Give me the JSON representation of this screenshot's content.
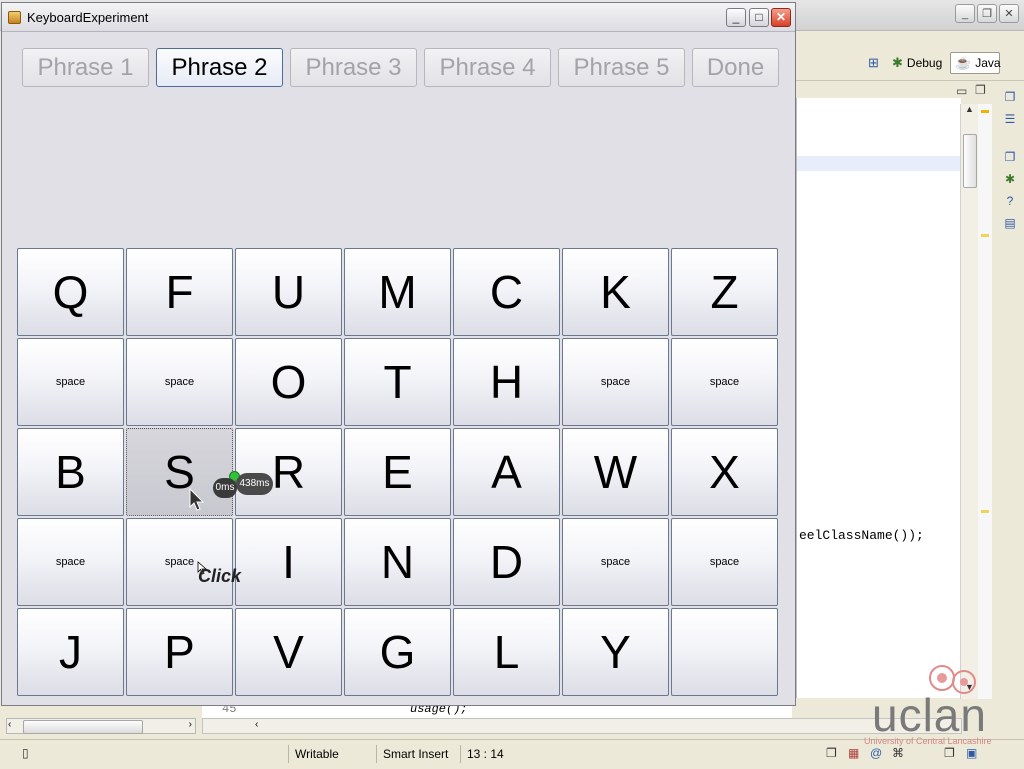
{
  "ide": {
    "perspectives": [
      {
        "label": "Debug",
        "icon": "debug-bug-icon"
      },
      {
        "label": "Java",
        "icon": "java-perspective-icon"
      }
    ],
    "code_fragment": "eelClassName());",
    "line_number": "45",
    "code_usage": "usage();",
    "status": {
      "writable": "Writable",
      "insert_mode": "Smart Insert",
      "position": "13 : 14"
    },
    "logo": {
      "name": "uclan",
      "subtitle": "University of Central Lancashire"
    }
  },
  "app": {
    "title": "KeyboardExperiment",
    "phase_buttons": [
      {
        "label": "Phrase 1",
        "active": false
      },
      {
        "label": "Phrase 2",
        "active": true
      },
      {
        "label": "Phrase 3",
        "active": false
      },
      {
        "label": "Phrase 4",
        "active": false
      },
      {
        "label": "Phrase 5",
        "active": false
      },
      {
        "label": "Done",
        "active": false
      }
    ],
    "keyboard_rows": [
      [
        "Q",
        "F",
        "U",
        "M",
        "C",
        "K",
        "Z"
      ],
      [
        "space",
        "space",
        "O",
        "T",
        "H",
        "space",
        "space"
      ],
      [
        "B",
        "S",
        "R",
        "E",
        "A",
        "W",
        "X"
      ],
      [
        "space",
        "space",
        "I",
        "N",
        "D",
        "space",
        "space"
      ],
      [
        "J",
        "P",
        "V",
        "G",
        "L",
        "Y",
        ""
      ]
    ],
    "pressed_key": {
      "row": 2,
      "col": 1
    }
  },
  "overlay": {
    "timer_start": "0ms",
    "timer_elapsed": "438ms",
    "click_label": "Click"
  },
  "colors": {
    "ide_bg": "#ece9d8",
    "app_bg": "#e1e0e6",
    "active_phase_border": "#4f6b9a",
    "inactive_phase_text": "#a3a3a8"
  }
}
